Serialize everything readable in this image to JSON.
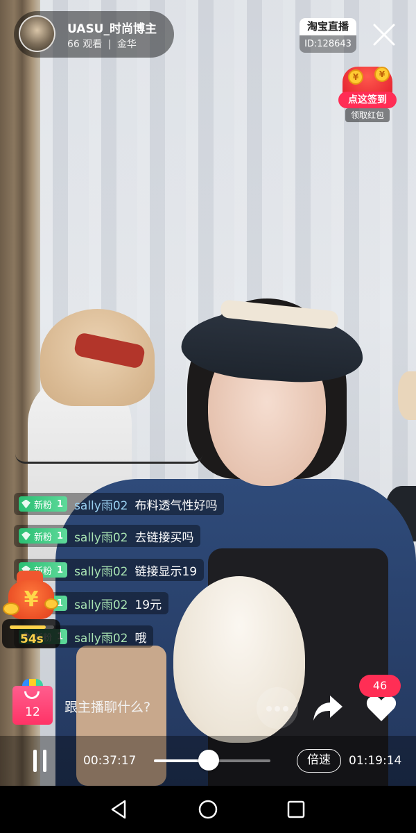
{
  "header": {
    "anchor_name": "UASU_时尚博主",
    "viewers": "66 观看",
    "separator": "|",
    "location": "金华",
    "platform_label": "淘宝直播",
    "room_id": "ID:128643"
  },
  "signin": {
    "button_label": "点这签到",
    "sub_label": "领取红包",
    "coin_symbol": "¥"
  },
  "comments": [
    {
      "badge": "新粉",
      "level": "1",
      "user": "sally雨02",
      "text": "布料透气性好吗"
    },
    {
      "badge": "新粉",
      "level": "1",
      "user": "sally雨02",
      "text": "去链接买吗"
    },
    {
      "badge": "新粉",
      "level": "1",
      "user": "sally雨02",
      "text": "链接显示19"
    },
    {
      "badge": "新粉",
      "level": "1",
      "user": "sally雨02",
      "text": "19元"
    },
    {
      "badge": "新粉",
      "level": "1",
      "user": "sally雨02",
      "text": "哦"
    }
  ],
  "lucky_bag": {
    "symbol": "¥",
    "countdown": "54s",
    "progress": 0.82
  },
  "actions": {
    "bag_count": "12",
    "chat_placeholder": "跟主播聊什么?",
    "like_count": "46"
  },
  "playback": {
    "current_time": "00:37:17",
    "total_time": "01:19:14",
    "progress": 0.47,
    "speed_label": "倍速"
  },
  "icons": {
    "close": "close-icon",
    "share": "share-icon",
    "like": "heart-icon",
    "more": "more-icon",
    "pause": "pause-icon",
    "nav_back": "back-icon",
    "nav_home": "home-icon",
    "nav_recent": "recent-apps-icon"
  },
  "colors": {
    "accent_pink": "#ff2e55",
    "fan_badge_green": "#2bbf73",
    "username_green": "#a9e4b3",
    "username_blue": "#9ad0f0",
    "timer_gold": "#ffd24a"
  }
}
